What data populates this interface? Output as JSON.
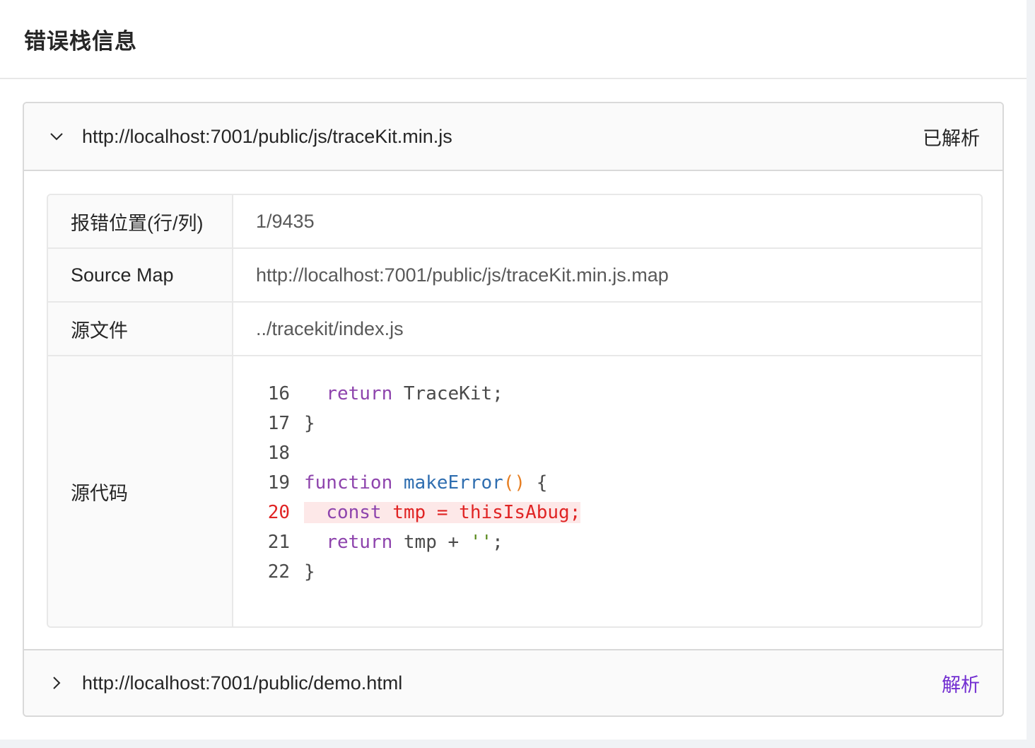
{
  "card": {
    "title": "错误栈信息"
  },
  "panels": [
    {
      "url": "http://localhost:7001/public/js/traceKit.min.js",
      "status": "已解析",
      "expanded": true,
      "details": {
        "position_label": "报错位置(行/列)",
        "position_value": "1/9435",
        "sourcemap_label": "Source Map",
        "sourcemap_value": "http://localhost:7001/public/js/traceKit.min.js.map",
        "source_file_label": "源文件",
        "source_file_value": "../tracekit/index.js",
        "source_code_label": "源代码",
        "code": [
          {
            "ln": "16",
            "text": "  return TraceKit;"
          },
          {
            "ln": "17",
            "text": "}"
          },
          {
            "ln": "18",
            "text": ""
          },
          {
            "ln": "19",
            "text": "function makeError() {"
          },
          {
            "ln": "20",
            "text": "  const tmp = thisIsAbug;",
            "error": true
          },
          {
            "ln": "21",
            "text": "  return tmp + '';"
          },
          {
            "ln": "22",
            "text": "}"
          }
        ]
      }
    },
    {
      "url": "http://localhost:7001/public/demo.html",
      "action": "解析",
      "expanded": false
    }
  ],
  "colors": {
    "accent": "#722ed1",
    "error": "#e02424",
    "error_bg": "#fde8e8"
  }
}
